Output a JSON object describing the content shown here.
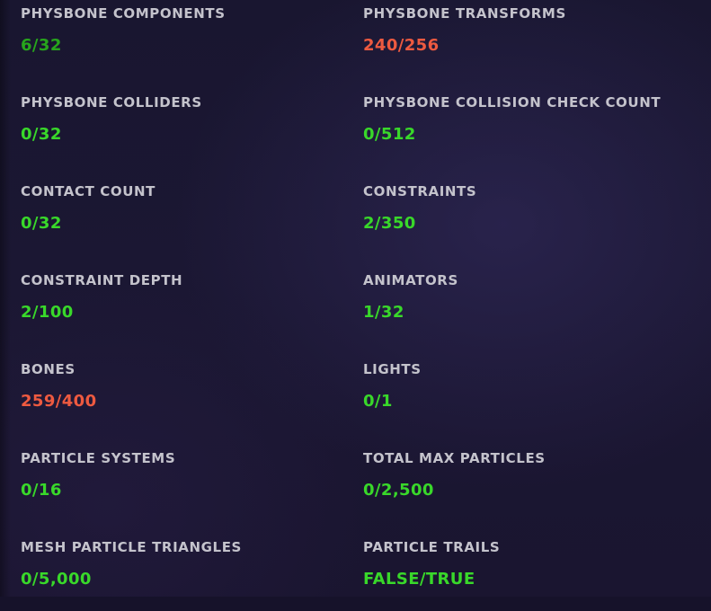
{
  "stats": [
    {
      "label": "PHYSBONE COMPONENTS",
      "value": "6/32",
      "status": "ok-dim"
    },
    {
      "label": "PHYSBONE TRANSFORMS",
      "value": "240/256",
      "status": "warn"
    },
    {
      "label": "PHYSBONE COLLIDERS",
      "value": "0/32",
      "status": "ok"
    },
    {
      "label": "PHYSBONE COLLISION CHECK COUNT",
      "value": "0/512",
      "status": "ok"
    },
    {
      "label": "CONTACT COUNT",
      "value": "0/32",
      "status": "ok"
    },
    {
      "label": "CONSTRAINTS",
      "value": "2/350",
      "status": "ok"
    },
    {
      "label": "CONSTRAINT DEPTH",
      "value": "2/100",
      "status": "ok"
    },
    {
      "label": "ANIMATORS",
      "value": "1/32",
      "status": "ok"
    },
    {
      "label": "BONES",
      "value": "259/400",
      "status": "warn"
    },
    {
      "label": "LIGHTS",
      "value": "0/1",
      "status": "ok"
    },
    {
      "label": "PARTICLE SYSTEMS",
      "value": "0/16",
      "status": "ok"
    },
    {
      "label": "TOTAL MAX PARTICLES",
      "value": "0/2,500",
      "status": "ok"
    },
    {
      "label": "MESH PARTICLE TRIANGLES",
      "value": "0/5,000",
      "status": "ok"
    },
    {
      "label": "PARTICLE TRAILS",
      "value": "FALSE/TRUE",
      "status": "ok"
    }
  ],
  "colors": {
    "label": "#c4c3cc",
    "ok": "#39d82a",
    "ok_dim": "#27a51c",
    "warn": "#ee5a40",
    "background": "#1a1530"
  }
}
